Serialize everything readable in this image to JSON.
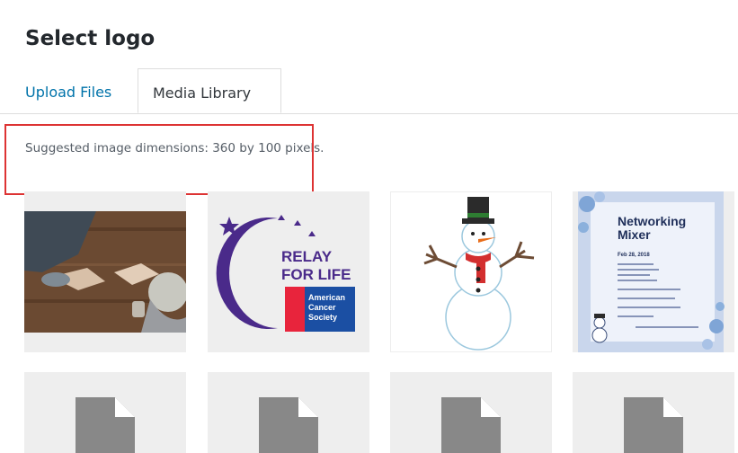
{
  "modal": {
    "title": "Select logo"
  },
  "tabs": [
    {
      "label": "Upload Files",
      "active": false
    },
    {
      "label": "Media Library",
      "active": true
    }
  ],
  "suggestion": "Suggested image dimensions: 360 by 100 pixels.",
  "colors": {
    "link": "#0073aa",
    "highlight": "#dd3333",
    "relay_purple": "#4a2a8a",
    "relay_blue": "#1b4fa3"
  },
  "media": [
    {
      "type": "image",
      "description": "photo",
      "icon": "photo-handshake"
    },
    {
      "type": "image",
      "icon": "relay-for-life-logo",
      "logo_text": [
        "RELAY",
        "FOR LIFE",
        "American",
        "Cancer",
        "Society"
      ]
    },
    {
      "type": "image",
      "icon": "snowman-clipart"
    },
    {
      "type": "image",
      "icon": "networking-mixer-flyer",
      "flyer_title": [
        "Networking",
        "Mixer"
      ],
      "flyer_date": "Feb 28, 2018"
    },
    {
      "type": "document",
      "icon": "file-icon"
    },
    {
      "type": "document",
      "icon": "file-icon"
    },
    {
      "type": "document",
      "icon": "file-icon"
    },
    {
      "type": "document",
      "icon": "file-icon"
    }
  ]
}
